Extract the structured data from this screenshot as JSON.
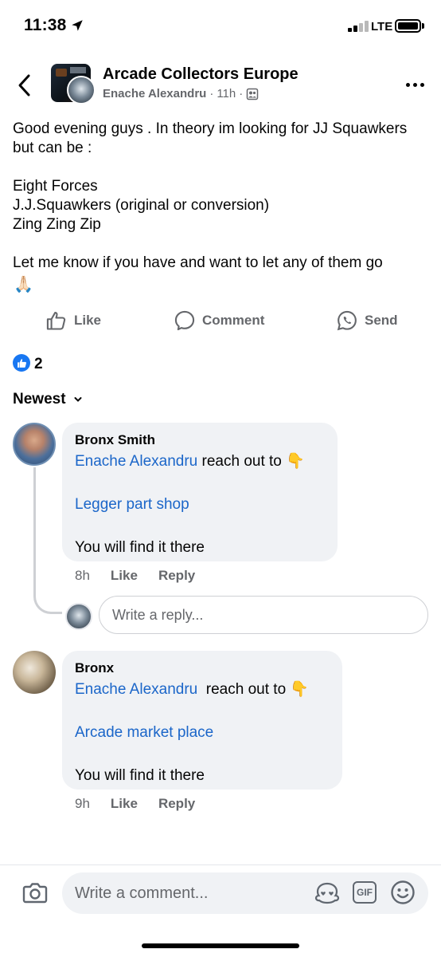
{
  "status_bar": {
    "time": "11:38",
    "network": "LTE",
    "icons": [
      "location-arrow-icon",
      "signal-icon",
      "battery-icon"
    ]
  },
  "header": {
    "group_name": "Arcade Collectors Europe",
    "author": "Enache Alexandru",
    "separator": "·",
    "time": "11h",
    "audience_icon": "group-members-icon"
  },
  "post": {
    "text": "Good evening guys . In theory im looking for JJ Squawkers but can be :\n\nEight Forces\nJ.J.Squawkers (original or conversion)\nZing Zing Zip\n\nLet me know if you have and want to let any of them go",
    "emoji": "🙏🏻"
  },
  "actions": {
    "like": "Like",
    "comment": "Comment",
    "send": "Send"
  },
  "reactions": {
    "count": "2",
    "icon": "like-reaction-icon"
  },
  "sort": {
    "label": "Newest"
  },
  "comments": [
    {
      "name": "Bronx Smith",
      "mention": "Enache Alexandru",
      "text1": " reach out to ",
      "emoji": "👇",
      "link": "Legger part shop",
      "text2": "You will find it there",
      "time": "8h",
      "like": "Like",
      "reply": "Reply"
    },
    {
      "name": "Bronx",
      "mention": "Enache Alexandru",
      "text1": "  reach out to ",
      "emoji": "👇",
      "link": "Arcade market place",
      "text2": "You will find it there",
      "time": "9h",
      "like": "Like",
      "reply": "Reply"
    }
  ],
  "reply_box": {
    "placeholder": "Write a reply..."
  },
  "composer": {
    "placeholder": "Write a comment...",
    "gif_label": "GIF"
  },
  "colors": {
    "link_blue": "#1b66c9",
    "brand_blue": "#1877f2",
    "muted": "#65676b",
    "bubble": "#f0f2f5"
  }
}
